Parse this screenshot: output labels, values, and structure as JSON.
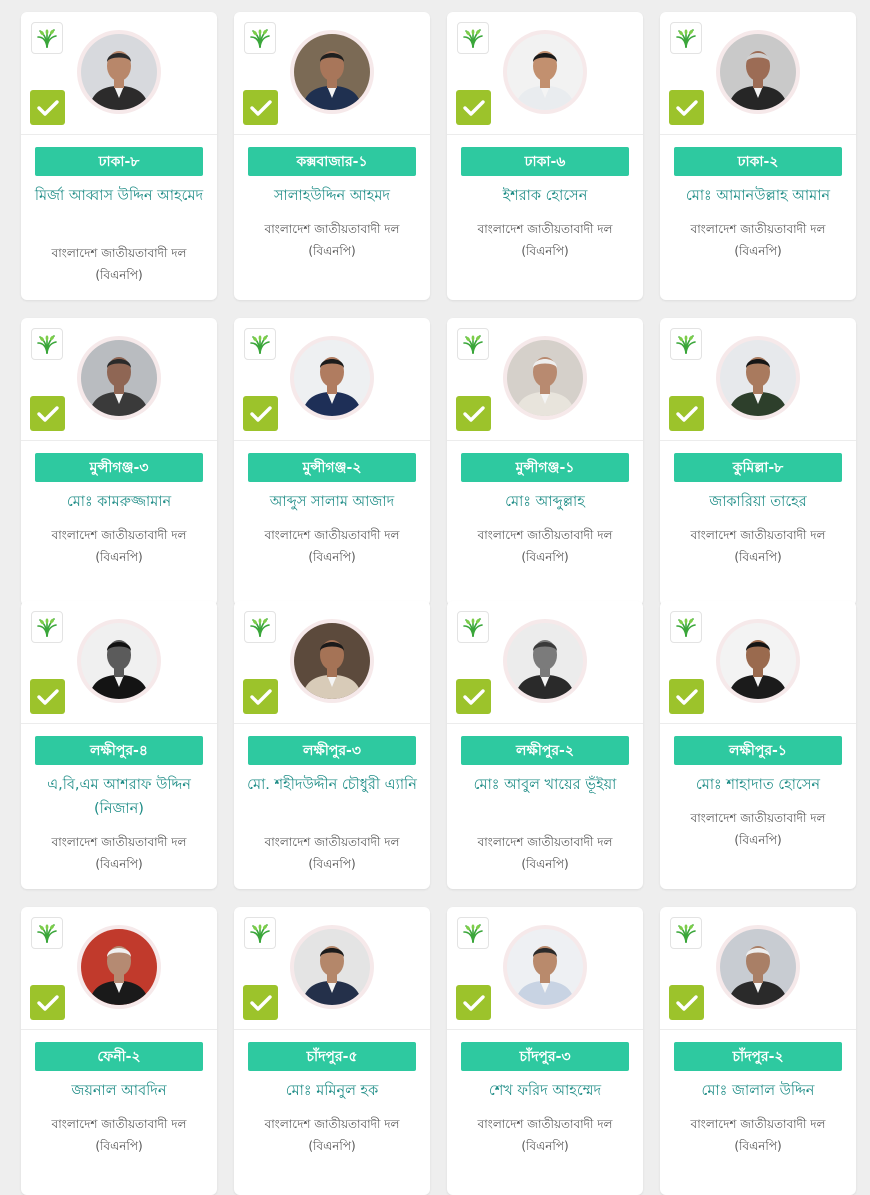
{
  "party": {
    "name": "বাংলাদেশ জাতীয়তাবাদী দল",
    "abbr": "(বিএনপি)",
    "colors": {
      "badge": "#2ec9a0",
      "check": "#9cc32b",
      "name_text": "#1d8c86",
      "logo": "#3aa63a"
    },
    "logo_icon": "sheaf-of-paddy-icon",
    "status_icon": "checkmark-icon"
  },
  "candidates": [
    {
      "seat": "ঢাকা-৮",
      "name": "মির্জা আব্বাস উদ্দিন আহমেদ",
      "party_name": "বাংলাদেশ জাতীয়তাবাদী দল",
      "party_abbr": "(বিএনপি)",
      "photo": {
        "bg": "#d7d9dd",
        "skin": "#b8876a",
        "hair": "#2b2b2b",
        "suit": "#2c2b2b"
      }
    },
    {
      "seat": "কক্সবাজার-১",
      "name": "সালাহউদ্দিন আহমদ",
      "party_name": "বাংলাদেশ জাতীয়তাবাদী দল",
      "party_abbr": "(বিএনপি)",
      "photo": {
        "bg": "#7b6a55",
        "skin": "#a8765a",
        "hair": "#1f1f1f",
        "suit": "#1f3050"
      }
    },
    {
      "seat": "ঢাকা-৬",
      "name": "ইশরাক হোসেন",
      "party_name": "বাংলাদেশ জাতীয়তাবাদী দল",
      "party_abbr": "(বিএনপি)",
      "photo": {
        "bg": "#f2f2f2",
        "skin": "#c2906f",
        "hair": "#1a1a1a",
        "suit": "#e9ecef"
      }
    },
    {
      "seat": "ঢাকা-২",
      "name": "মোঃ আমানউল্লাহ আমান",
      "party_name": "বাংলাদেশ জাতীয়তাবাদী দল",
      "party_abbr": "(বিএনপি)",
      "photo": {
        "bg": "#c9c9c9",
        "skin": "#9c6c55",
        "hair": "#cfcfcf",
        "suit": "#262626"
      }
    },
    {
      "seat": "মুন্সীগঞ্জ-৩",
      "name": "মোঃ কামরুজ্জামান",
      "party_name": "বাংলাদেশ জাতীয়তাবাদী দল",
      "party_abbr": "(বিএনপি)",
      "photo": {
        "bg": "#b9bcc0",
        "skin": "#8f6654",
        "hair": "#2a2a2a",
        "suit": "#3a3a3a"
      }
    },
    {
      "seat": "মুন্সীগঞ্জ-২",
      "name": "আব্দুস সালাম আজাদ",
      "party_name": "বাংলাদেশ জাতীয়তাবাদী দল",
      "party_abbr": "(বিএনপি)",
      "photo": {
        "bg": "#eef0f2",
        "skin": "#b07c60",
        "hair": "#1c1c1c",
        "suit": "#1e2f57"
      }
    },
    {
      "seat": "মুন্সীগঞ্জ-১",
      "name": "মোঃ আব্দুল্লাহ",
      "party_name": "বাংলাদেশ জাতীয়তাবাদী দল",
      "party_abbr": "(বিএনপি)",
      "photo": {
        "bg": "#d5d0ca",
        "skin": "#b88a70",
        "hair": "#eeeeee",
        "suit": "#e8e4dc"
      }
    },
    {
      "seat": "কুমিল্লা-৮",
      "name": "জাকারিয়া তাহের",
      "party_name": "বাংলাদেশ জাতীয়তাবাদী দল",
      "party_abbr": "(বিএনপি)",
      "photo": {
        "bg": "#e7e9ec",
        "skin": "#a97a5e",
        "hair": "#161616",
        "suit": "#2d3f2b"
      }
    },
    {
      "seat": "লক্ষীপুর-৪",
      "name": "এ,বি,এম আশরাফ উদ্দিন (নিজান)",
      "party_name": "বাংলাদেশ জাতীয়তাবাদী দল",
      "party_abbr": "(বিএনপি)",
      "photo": {
        "bg": "#f0f0f0",
        "skin": "#5b5b5b",
        "hair": "#111111",
        "suit": "#141414"
      }
    },
    {
      "seat": "লক্ষীপুর-৩",
      "name": "মো. শহীদউদ্দীন চৌধুরী এ্যানি",
      "party_name": "বাংলাদেশ জাতীয়তাবাদী দল",
      "party_abbr": "(বিএনপি)",
      "photo": {
        "bg": "#5c4a3c",
        "skin": "#a57356",
        "hair": "#1a1a1a",
        "suit": "#d8cbb8"
      }
    },
    {
      "seat": "লক্ষীপুর-২",
      "name": "মোঃ আবুল খায়ের ভূঁইয়া",
      "party_name": "বাংলাদেশ জাতীয়তাবাদী দল",
      "party_abbr": "(বিএনপি)",
      "photo": {
        "bg": "#ececec",
        "skin": "#7b7b7b",
        "hair": "#3a3a3a",
        "suit": "#2a2a2a"
      }
    },
    {
      "seat": "লক্ষীপুর-১",
      "name": "মোঃ শাহাদাত হোসেন",
      "party_name": "বাংলাদেশ জাতীয়তাবাদী দল",
      "party_abbr": "(বিএনপি)",
      "photo": {
        "bg": "#f3f3f3",
        "skin": "#9a6a4e",
        "hair": "#141414",
        "suit": "#1b1b1b"
      }
    },
    {
      "seat": "ফেনী-২",
      "name": "জয়নাল আবদিন",
      "party_name": "বাংলাদেশ জাতীয়তাবাদী দল",
      "party_abbr": "(বিএনপি)",
      "photo": {
        "bg": "#c13a2c",
        "skin": "#b58a72",
        "hair": "#f0f0f0",
        "suit": "#1a1a1a"
      }
    },
    {
      "seat": "চাঁদপুর-৫",
      "name": "মোঃ মমিনুল হক",
      "party_name": "বাংলাদেশ জাতীয়তাবাদী দল",
      "party_abbr": "(বিএনপি)",
      "photo": {
        "bg": "#e4e4e4",
        "skin": "#b4876a",
        "hair": "#1b1b1b",
        "suit": "#24304a"
      }
    },
    {
      "seat": "চাঁদপুর-৩",
      "name": "শেখ ফরিদ আহম্মেদ",
      "party_name": "বাংলাদেশ জাতীয়তাবাদী দল",
      "party_abbr": "(বিএনপি)",
      "photo": {
        "bg": "#eef0f3",
        "skin": "#b98a6c",
        "hair": "#2a2a2a",
        "suit": "#c8d3e3"
      }
    },
    {
      "seat": "চাঁদপুর-২",
      "name": "মোঃ জালাল উদ্দিন",
      "party_name": "বাংলাদেশ জাতীয়তাবাদী দল",
      "party_abbr": "(বিএনপি)",
      "photo": {
        "bg": "#c8ccd2",
        "skin": "#a97f66",
        "hair": "#eeeeee",
        "suit": "#2a2a2a"
      }
    }
  ]
}
